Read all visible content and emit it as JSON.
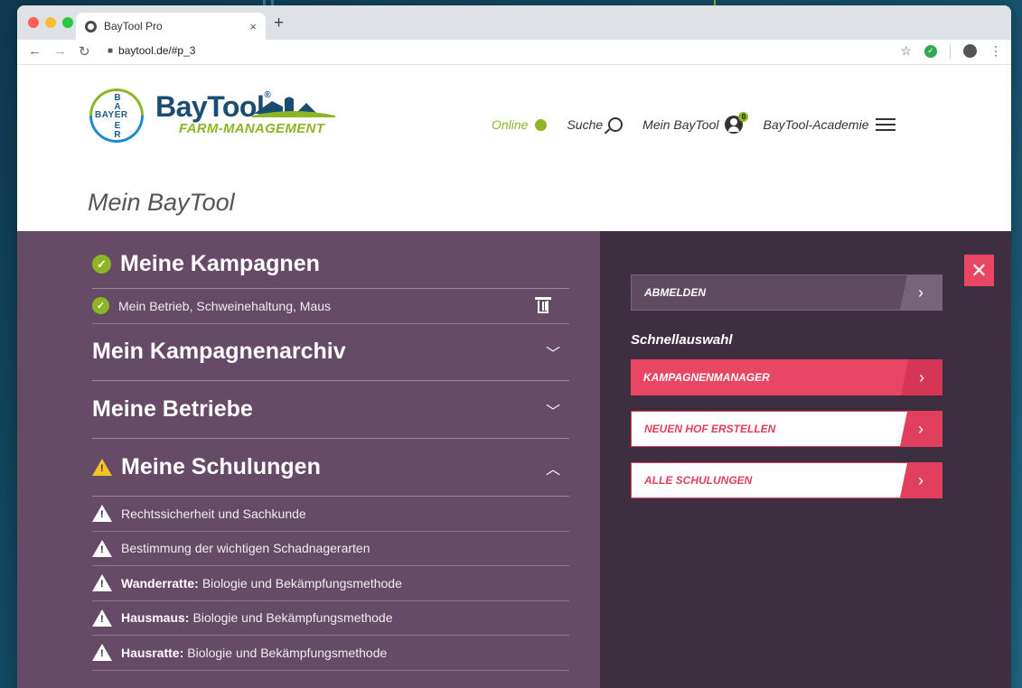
{
  "browser": {
    "tab_title": "BayTool Pro",
    "tab_close": "×",
    "new_tab": "+",
    "url": "baytool.de/#p_3"
  },
  "site": {
    "bayer_vertical": "B\nA\nY\nE\nR",
    "bayer_horizontal": "BAYER",
    "brand": "BayTool",
    "brand_reg": "®",
    "brand_sub": "FARM-MANAGEMENT",
    "nav": {
      "online": "Online",
      "search": "Suche",
      "my_baytool": "Mein BayTool",
      "badge": "0",
      "academy": "BayTool-Academie"
    },
    "page_title": "Mein BayTool"
  },
  "left": {
    "campaigns": {
      "title": "Meine Kampagnen",
      "items": [
        "Mein Betrieb, Schweinehaltung, Maus"
      ]
    },
    "archive": {
      "title": "Mein Kampagnenarchiv"
    },
    "farms": {
      "title": "Meine Betriebe"
    },
    "trainings": {
      "title": "Meine Schulungen",
      "items": [
        {
          "bold": "",
          "text": "Rechtssicherheit und Sachkunde"
        },
        {
          "bold": "",
          "text": "Bestimmung der wichtigen Schadnagerarten"
        },
        {
          "bold": "Wanderratte:",
          "text": "Biologie und Bekämpfungsmethode"
        },
        {
          "bold": "Hausmaus:",
          "text": "Biologie und Bekämpfungsmethode"
        },
        {
          "bold": "Hausratte:",
          "text": "Biologie und Bekämpfungsmethode"
        }
      ]
    }
  },
  "right": {
    "logout": "ABMELDEN",
    "quick_title": "Schnellauswahl",
    "buttons": [
      "KAMPAGNENMANAGER",
      "NEUEN HOF ERSTELLEN",
      "ALLE SCHULUNGEN"
    ],
    "arrow": "›",
    "close": "✕"
  },
  "colors": {
    "accent_green": "#8db526",
    "accent_red": "#e84663",
    "panel_left": "#654b66",
    "panel_right": "#3e2f40",
    "warning": "#f3c325"
  }
}
